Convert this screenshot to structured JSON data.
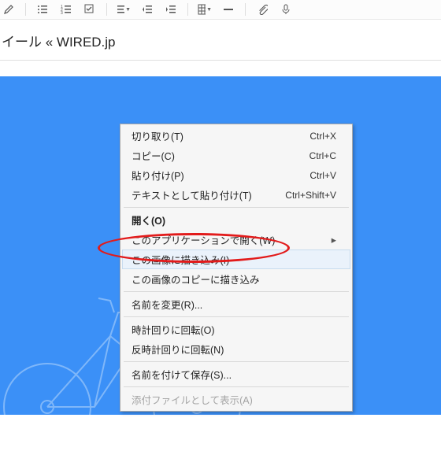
{
  "title": "イール « WIRED.jp",
  "toolbar_icons": [
    "pencil-icon",
    "bullet-list-icon",
    "numbered-list-icon",
    "checkbox-icon",
    "align-icon",
    "outdent-icon",
    "indent-icon",
    "table-icon",
    "hr-icon",
    "attachment-icon",
    "microphone-icon"
  ],
  "menu": {
    "groups": [
      [
        {
          "label": "切り取り(T)",
          "shortcut": "Ctrl+X"
        },
        {
          "label": "コピー(C)",
          "shortcut": "Ctrl+C"
        },
        {
          "label": "貼り付け(P)",
          "shortcut": "Ctrl+V"
        },
        {
          "label": "テキストとして貼り付け(T)",
          "shortcut": "Ctrl+Shift+V"
        }
      ],
      [
        {
          "label": "開く(O)",
          "bold": true
        },
        {
          "label": "このアプリケーションで開く(W)",
          "submenu": true
        },
        {
          "label": "この画像に描き込み(I)",
          "highlight": true
        },
        {
          "label": "この画像のコピーに描き込み"
        }
      ],
      [
        {
          "label": "名前を変更(R)..."
        }
      ],
      [
        {
          "label": "時計回りに回転(O)"
        },
        {
          "label": "反時計回りに回転(N)"
        }
      ],
      [
        {
          "label": "名前を付けて保存(S)..."
        }
      ],
      [
        {
          "label": "添付ファイルとして表示(A)",
          "disabled": true
        }
      ]
    ]
  }
}
